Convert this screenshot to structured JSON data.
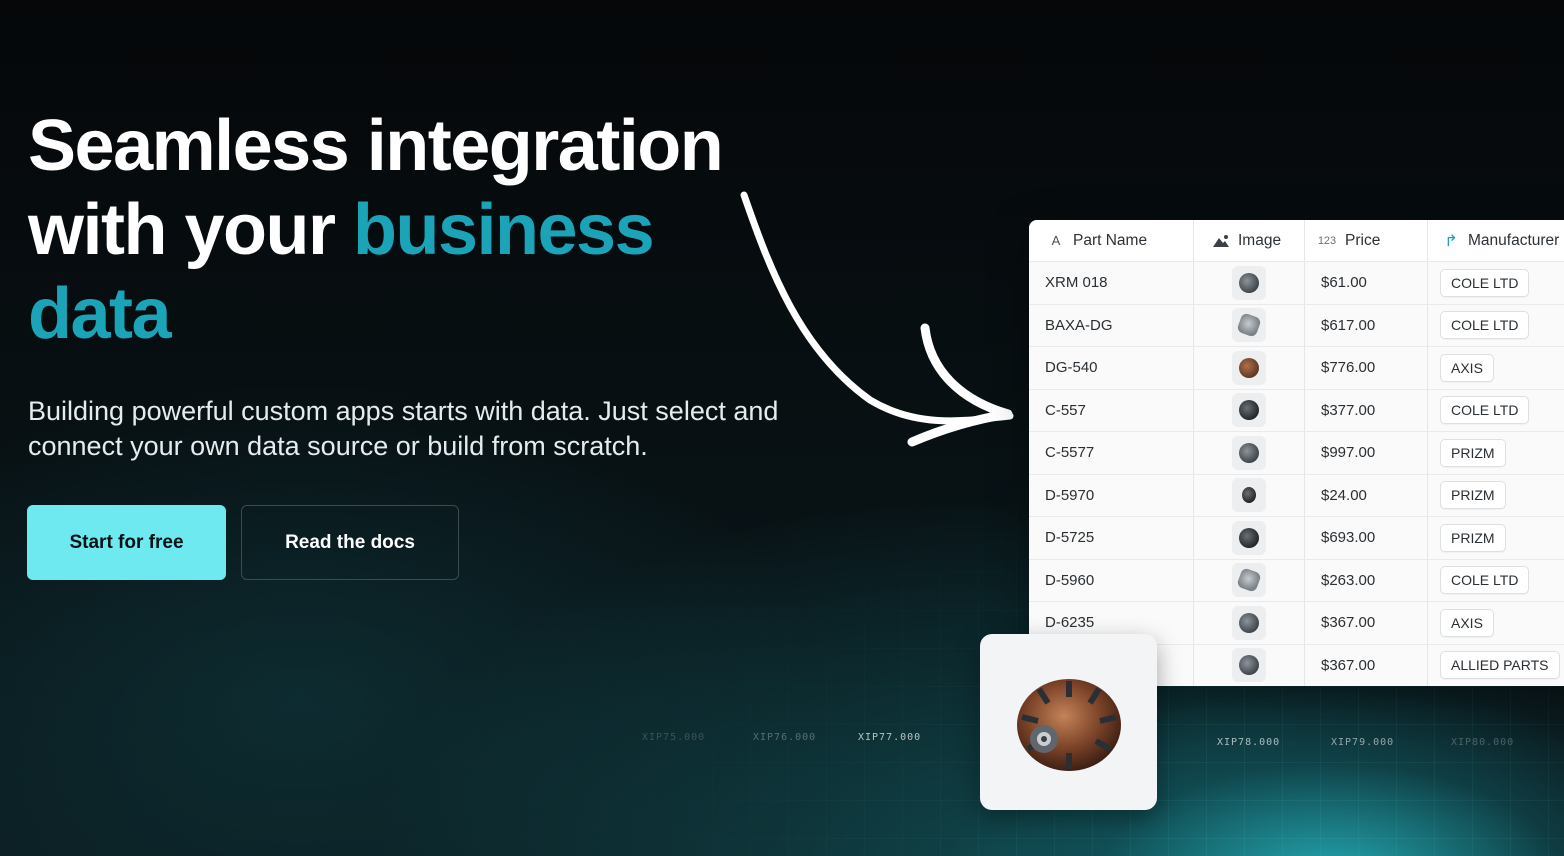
{
  "hero": {
    "headline_line1": "Seamless integration",
    "headline_line2_prefix": "with your ",
    "headline_accent_word": "business",
    "headline_accent_line3": "data",
    "subtitle": "Building powerful custom apps starts with data. Just select and connect your own data source or build from scratch.",
    "primary_button": "Start for free",
    "secondary_button": "Read the docs"
  },
  "colors": {
    "accent": "#1ba3b8",
    "primary_button_bg": "#6ee9ef",
    "background": "#060a0c"
  },
  "table": {
    "columns": [
      {
        "label": "Part Name",
        "icon": "text-type-icon"
      },
      {
        "label": "Image",
        "icon": "image-icon"
      },
      {
        "label": "Price",
        "icon": "number-type-icon",
        "icon_text": "123"
      },
      {
        "label": "Manufacturer",
        "icon": "relation-arrow-icon"
      }
    ],
    "rows": [
      {
        "part": "XRM 018",
        "image": "gray-disc-part",
        "price": "$61.00",
        "manufacturer": "COLE LTD"
      },
      {
        "part": "BAXA-DG",
        "image": "silver-gear-part",
        "price": "$617.00",
        "manufacturer": "COLE LTD"
      },
      {
        "part": "DG-540",
        "image": "copper-rotor-part",
        "price": "$776.00",
        "manufacturer": "AXIS"
      },
      {
        "part": "C-557",
        "image": "dark-spring-part",
        "price": "$377.00",
        "manufacturer": "COLE LTD"
      },
      {
        "part": "C-5577",
        "image": "gray-motor-part",
        "price": "$997.00",
        "manufacturer": "PRIZM"
      },
      {
        "part": "D-5970",
        "image": "dark-cone-part",
        "price": "$24.00",
        "manufacturer": "PRIZM"
      },
      {
        "part": "D-5725",
        "image": "dark-gear-part",
        "price": "$693.00",
        "manufacturer": "PRIZM"
      },
      {
        "part": "D-5960",
        "image": "silver-cog-part",
        "price": "$263.00",
        "manufacturer": "COLE LTD"
      },
      {
        "part": "D-6235",
        "image": "gray-motor-part",
        "price": "$367.00",
        "manufacturer": "AXIS"
      },
      {
        "part": "",
        "image": "gray-disc-part",
        "price": "$367.00",
        "manufacturer": "ALLIED PARTS"
      }
    ]
  },
  "background_ticks": [
    "XIP75.000",
    "XIP76.000",
    "XIP77.000",
    "XIP78.000",
    "XIP79.000",
    "XIP80.000"
  ],
  "product_card": {
    "image": "copper-motor-rotor"
  }
}
